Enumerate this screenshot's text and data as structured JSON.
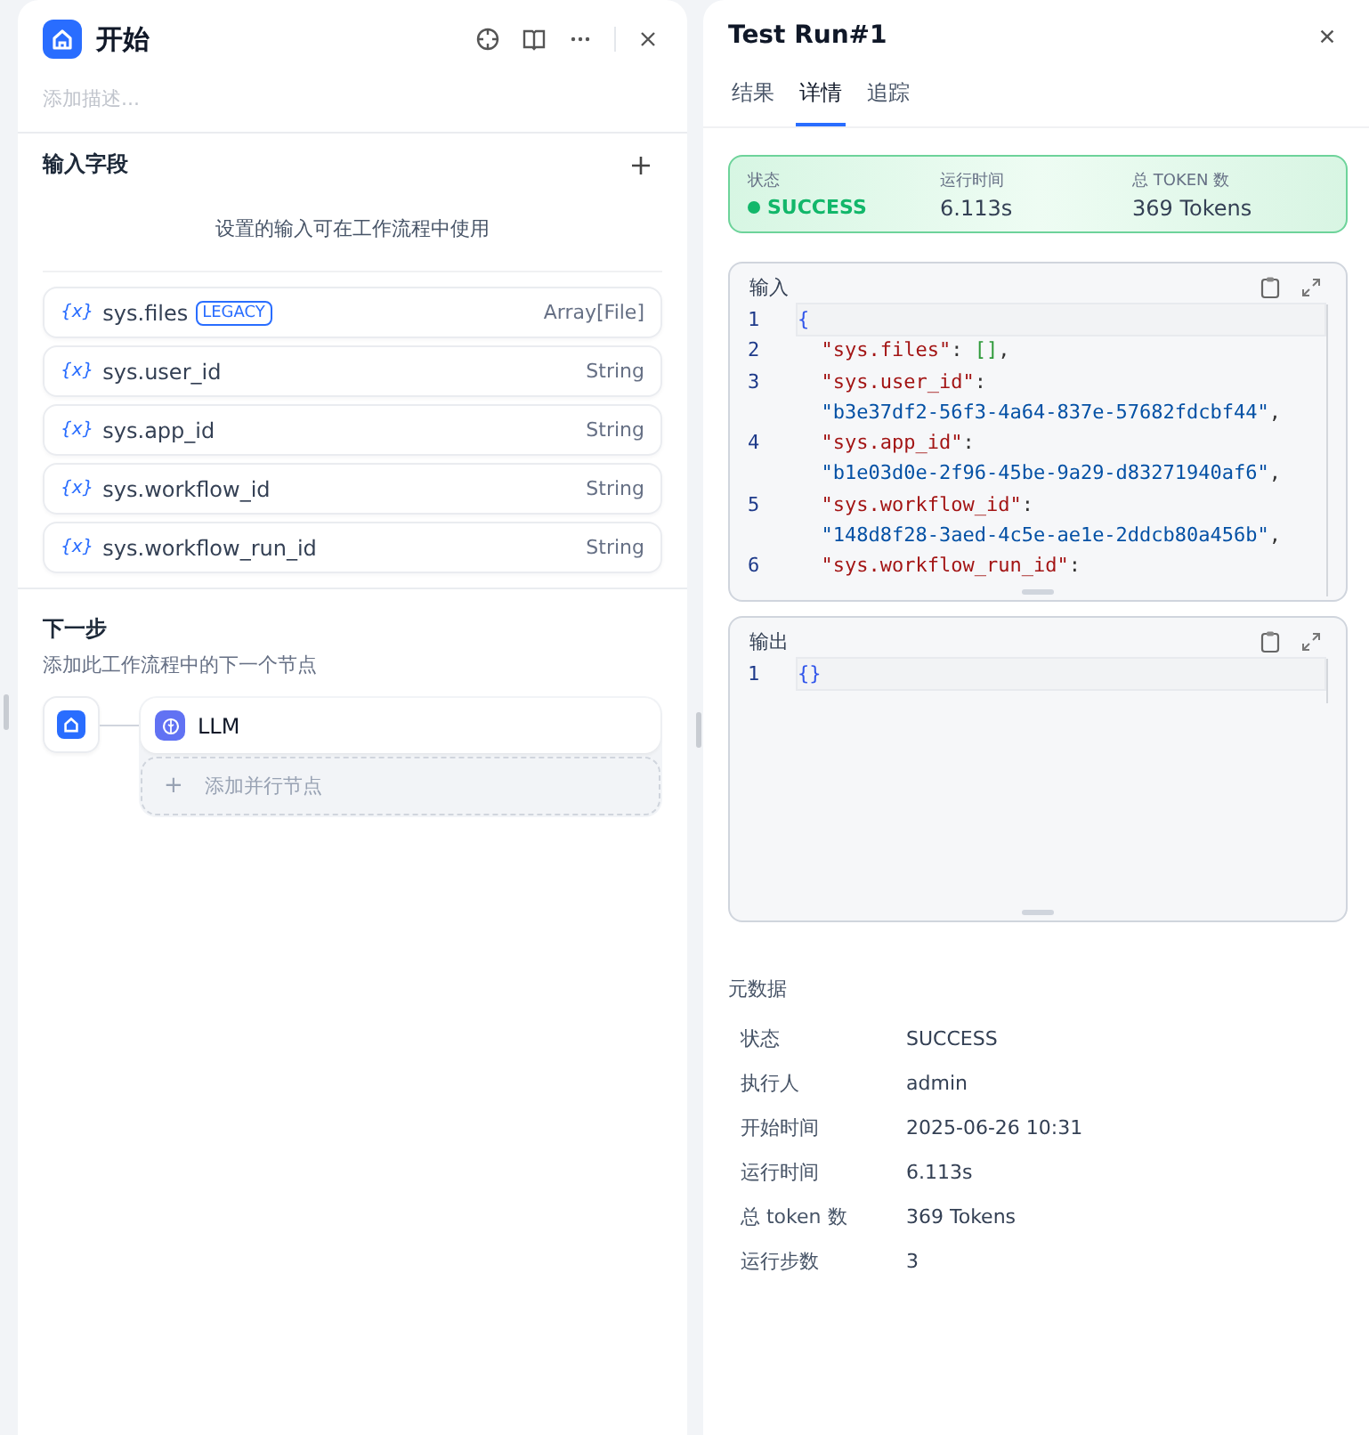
{
  "node_panel": {
    "title": "开始",
    "description_placeholder": "添加描述...",
    "input_section": {
      "title": "输入字段",
      "hint": "设置的输入可在工作流程中使用",
      "fields": [
        {
          "icon": "{x}",
          "name": "sys.files",
          "badge": "LEGACY",
          "type": "Array[File]"
        },
        {
          "icon": "{x}",
          "name": "sys.user_id",
          "type": "String"
        },
        {
          "icon": "{x}",
          "name": "sys.app_id",
          "type": "String"
        },
        {
          "icon": "{x}",
          "name": "sys.workflow_id",
          "type": "String"
        },
        {
          "icon": "{x}",
          "name": "sys.workflow_run_id",
          "type": "String"
        }
      ]
    },
    "next_step": {
      "title": "下一步",
      "hint": "添加此工作流程中的下一个节点",
      "node": "LLM",
      "add_parallel": "添加并行节点",
      "add_icon": "+"
    }
  },
  "run_panel": {
    "title": "Test Run#1",
    "tabs": [
      {
        "label": "结果",
        "selected": false
      },
      {
        "label": "详情",
        "selected": true
      },
      {
        "label": "追踪",
        "selected": false
      }
    ],
    "summary": [
      {
        "label": "状态",
        "value": "SUCCESS",
        "kind": "status",
        "color": "#12b76a"
      },
      {
        "label": "运行时间",
        "value": "6.113s",
        "kind": "plain"
      },
      {
        "label": "总 TOKEN 数",
        "value": "369 Tokens",
        "kind": "plain"
      }
    ],
    "editors": [
      {
        "title": "输入",
        "lines": [
          {
            "number": "1",
            "tokens": [
              {
                "kind": "brace",
                "text": "{"
              }
            ]
          },
          {
            "number": "2",
            "tokens": [
              {
                "kind": "key",
                "text": "  \"sys.files\""
              },
              {
                "kind": "punct",
                "text": ": "
              },
              {
                "kind": "bracket",
                "text": "[]"
              },
              {
                "kind": "punct",
                "text": ","
              }
            ]
          },
          {
            "number": "3",
            "tokens": [
              {
                "kind": "key",
                "text": "  \"sys.user_id\""
              },
              {
                "kind": "punct",
                "text": ":"
              }
            ]
          },
          {
            "tokens": [
              {
                "kind": "value",
                "text": "  \"b3e37df2-56f3-4a64-837e-57682fdcbf44\""
              },
              {
                "kind": "punct",
                "text": ","
              }
            ]
          },
          {
            "number": "4",
            "tokens": [
              {
                "kind": "key",
                "text": "  \"sys.app_id\""
              },
              {
                "kind": "punct",
                "text": ":"
              }
            ]
          },
          {
            "tokens": [
              {
                "kind": "value",
                "text": "  \"b1e03d0e-2f96-45be-9a29-d83271940af6\""
              },
              {
                "kind": "punct",
                "text": ","
              }
            ]
          },
          {
            "number": "5",
            "tokens": [
              {
                "kind": "key",
                "text": "  \"sys.workflow_id\""
              },
              {
                "kind": "punct",
                "text": ":"
              }
            ]
          },
          {
            "tokens": [
              {
                "kind": "value",
                "text": "  \"148d8f28-3aed-4c5e-ae1e-2ddcb80a456b\""
              },
              {
                "kind": "punct",
                "text": ","
              }
            ]
          },
          {
            "number": "6",
            "tokens": [
              {
                "kind": "key",
                "text": "  \"sys.workflow_run_id\""
              },
              {
                "kind": "punct",
                "text": ":"
              }
            ]
          }
        ]
      },
      {
        "title": "输出",
        "lines": [
          {
            "number": "1",
            "tokens": [
              {
                "kind": "brace",
                "text": "{}"
              }
            ]
          }
        ]
      }
    ],
    "metadata": {
      "title": "元数据",
      "rows": [
        {
          "label": "状态",
          "value": "SUCCESS"
        },
        {
          "label": "执行人",
          "value": "admin"
        },
        {
          "label": "开始时间",
          "value": "2025-06-26 10:31"
        },
        {
          "label": "运行时间",
          "value": "6.113s"
        },
        {
          "label": "总 token 数",
          "value": "369 Tokens"
        },
        {
          "label": "运行步数",
          "value": "3"
        }
      ]
    }
  }
}
